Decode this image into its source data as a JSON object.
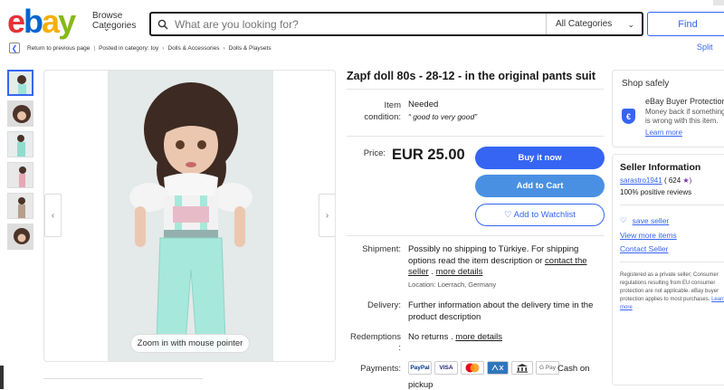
{
  "header": {
    "logo": [
      "e",
      "b",
      "a",
      "y"
    ],
    "browse": "Browse Categories",
    "search_placeholder": "What are you looking for?",
    "category": "All Categories",
    "find": "Find"
  },
  "breadcrumb": {
    "back": "Return to previous page",
    "posted": "Posted in category: toy",
    "crumb1": "Dolls & Accessories",
    "crumb2": "Dolls & Playsets",
    "split": "Split"
  },
  "gallery": {
    "zoom_hint": "Zoom in with mouse pointer"
  },
  "item": {
    "title": "Zapf doll 80s - 28-12 - in the original pants suit",
    "condition_label": "Item condition:",
    "condition_value": "Needed",
    "condition_note": "“ good to very good”",
    "price_label": "Price:",
    "price": "EUR 25.00",
    "buy_now": "Buy it now",
    "add_to_cart": "Add to Cart",
    "watchlist": "♡ Add to Watchlist",
    "shipment_label": "Shipment:",
    "shipment_text1": "Possibly no shipping to Türkiye. For shipping options read the item description or ",
    "shipment_link1": "contact the seller",
    "shipment_text2": " . ",
    "shipment_link2": "more details",
    "location": "Location: Loerrach, Germany",
    "delivery_label": "Delivery:",
    "delivery_text": "Further information about the delivery time in the product description",
    "redemptions_label": "Redemptions :",
    "redemptions_text": "No returns . ",
    "redemptions_link": "more details",
    "payments_label": "Payments:",
    "payment_methods": [
      "PayPal",
      "VISA",
      "MC",
      "AMEX",
      "Bank",
      "G Pay"
    ],
    "cash": "Cash on",
    "pickup": "pickup"
  },
  "shop_safely": {
    "title": "Shop safely",
    "heading": "eBay Buyer Protection",
    "body": "Money back if something is wrong with this item.",
    "link": "Learn more"
  },
  "seller": {
    "title": "Seller Information",
    "name": "sarastro1941",
    "feedback": "( 624",
    "star": "★)",
    "positive": "100% positive reviews",
    "save": "save seller",
    "view_more": "View more items",
    "contact": "Contact Seller",
    "note": "Registered as a private seller; Consumer regulations resulting from EU consumer protection are not applicable. eBay buyer protection applies to most purchases. ",
    "note_link": "Learn more"
  },
  "colors": {
    "accent": "#3665f3",
    "cart": "#4a90e2"
  }
}
